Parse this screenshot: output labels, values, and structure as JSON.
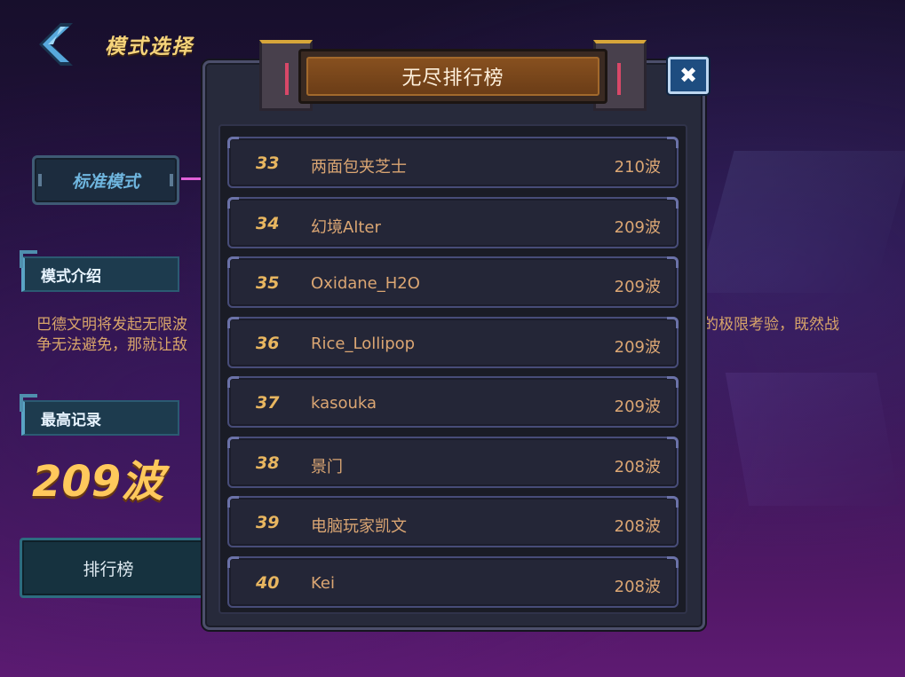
{
  "header": {
    "title": "模式选择",
    "back_icon": "chevron-left-icon"
  },
  "mode": {
    "label": "标准模式"
  },
  "intro": {
    "label": "模式介绍",
    "line1": "巴德文明将发起无限波",
    "line2": "争无法避免，那就让敌",
    "line_right": "的极限考验，既然战"
  },
  "record": {
    "label": "最高记录",
    "value": "209波"
  },
  "leaderboard_button": {
    "label": "排行榜"
  },
  "modal": {
    "title": "无尽排行榜",
    "close_label": "✖",
    "rows": [
      {
        "rank": "33",
        "name": "两面包夹芝士",
        "score": "210波"
      },
      {
        "rank": "34",
        "name": "幻境Alter",
        "score": "209波"
      },
      {
        "rank": "35",
        "name": "Oxidane_H2O",
        "score": "209波"
      },
      {
        "rank": "36",
        "name": "Rice_Lollipop",
        "score": "209波"
      },
      {
        "rank": "37",
        "name": "kasouka",
        "score": "209波"
      },
      {
        "rank": "38",
        "name": "景门",
        "score": "208波"
      },
      {
        "rank": "39",
        "name": "电脑玩家凯文",
        "score": "208波"
      },
      {
        "rank": "40",
        "name": "Kei",
        "score": "208波"
      }
    ]
  },
  "colors": {
    "gold_text": "#f5d37a",
    "score_text": "#dba673",
    "rank_text": "#e8b660",
    "close_button": "#1e4d80",
    "accent_pink": "#e060d8"
  }
}
